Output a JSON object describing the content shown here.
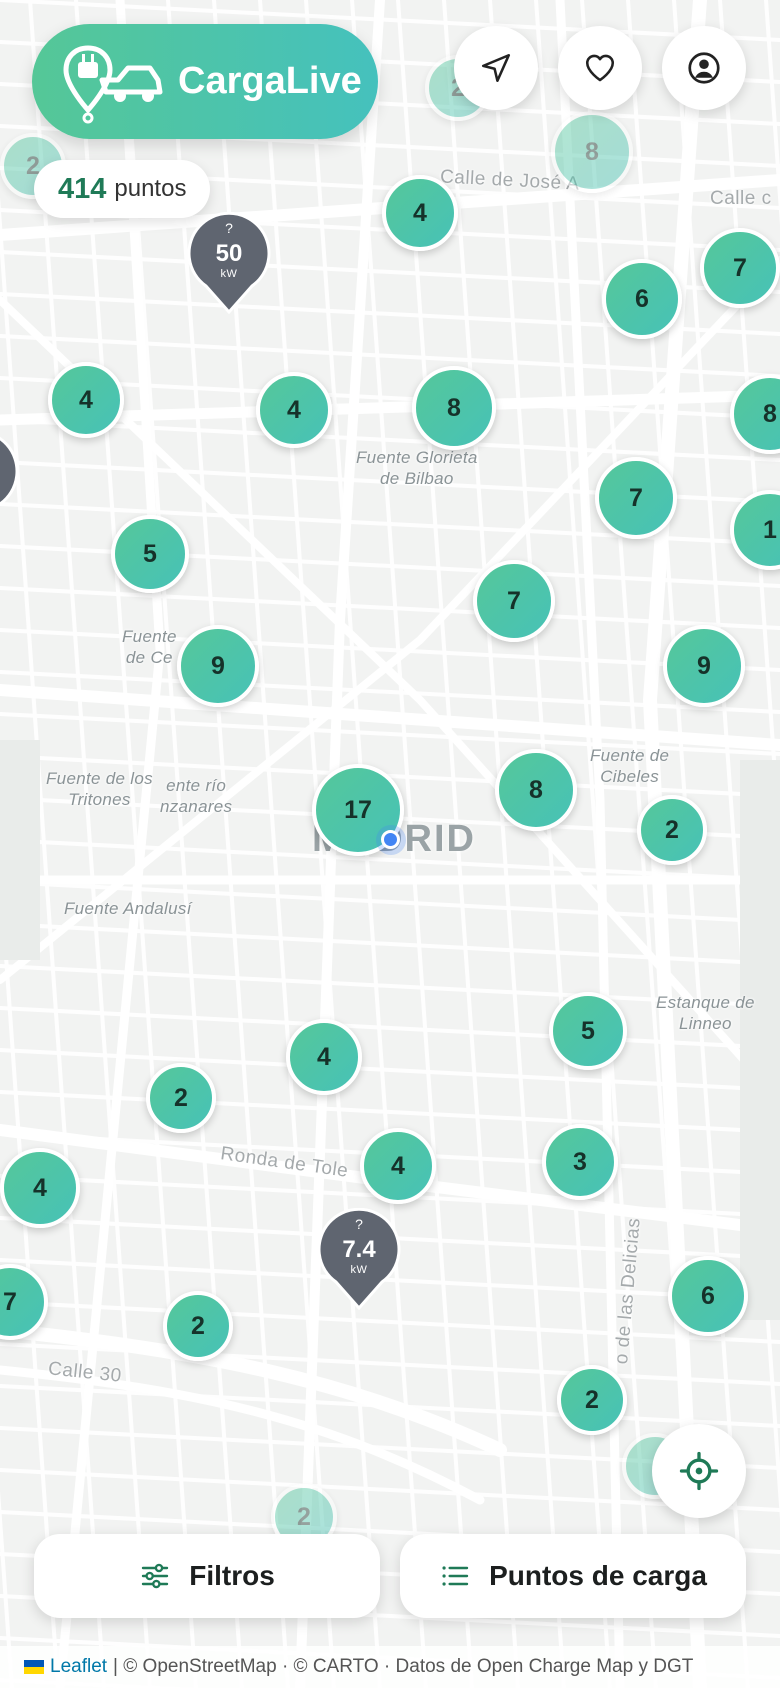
{
  "app": {
    "name": "CargaLive"
  },
  "header": {
    "navigate_icon": "navigation-arrow-icon",
    "favorites_icon": "heart-icon",
    "profile_icon": "user-circle-icon"
  },
  "points_count": {
    "number": "414",
    "label": "puntos"
  },
  "map": {
    "city_label": "MADRID",
    "user_location_icon": "blue-location-dot",
    "place_labels": [
      {
        "text": "Fuente Glorieta\nde Bilbao"
      },
      {
        "text": "Fuente de\nCibeles"
      },
      {
        "text": "Fuente de los\nTritones"
      },
      {
        "text": "ente río\nnzanares"
      },
      {
        "text": "Fuente Andalusí"
      },
      {
        "text": "Estanque de\nLinneo"
      },
      {
        "text": "Fuente\nde Ce"
      }
    ],
    "street_labels": [
      {
        "text": "Calle de José A"
      },
      {
        "text": "Ronda de Tole"
      },
      {
        "text": "Calle 30"
      },
      {
        "text": "Calle c"
      },
      {
        "text": "o de las Delicias"
      }
    ],
    "clusters": [
      {
        "count": "2",
        "faded": true
      },
      {
        "count": "8",
        "faded": true
      },
      {
        "count": "2",
        "faded": true
      },
      {
        "count": "4"
      },
      {
        "count": "7"
      },
      {
        "count": "6"
      },
      {
        "count": "4"
      },
      {
        "count": "4"
      },
      {
        "count": "8"
      },
      {
        "count": "8"
      },
      {
        "count": "7"
      },
      {
        "count": "1"
      },
      {
        "count": "5"
      },
      {
        "count": "7"
      },
      {
        "count": "9"
      },
      {
        "count": "9"
      },
      {
        "count": "17"
      },
      {
        "count": "8"
      },
      {
        "count": "2"
      },
      {
        "count": "5"
      },
      {
        "count": "4"
      },
      {
        "count": "2"
      },
      {
        "count": "4"
      },
      {
        "count": "4"
      },
      {
        "count": "3"
      },
      {
        "count": "7"
      },
      {
        "count": "2"
      },
      {
        "count": "6"
      },
      {
        "count": "2"
      },
      {
        "count": "2"
      },
      {
        "count": "2",
        "faded": true
      },
      {
        "count": "",
        "faded": true
      }
    ],
    "power_pins": [
      {
        "value": "50",
        "unit": "kW",
        "status_icon": "question-circle-icon"
      },
      {
        "value": "7.4",
        "unit": "kW",
        "status_icon": "question-circle-icon"
      }
    ]
  },
  "buttons": {
    "filters": "Filtros",
    "filters_icon": "sliders-icon",
    "charging_points": "Puntos de carga",
    "charging_points_icon": "list-icon",
    "locate_icon": "crosshair-icon"
  },
  "attribution": {
    "leaflet": "Leaflet",
    "rest": "| © OpenStreetMap · © CARTO · Datos de Open Charge Map y DGT"
  },
  "colors": {
    "brand_gradient_start": "#55c797",
    "brand_gradient_end": "#45c1bd",
    "cluster_text": "#16322a",
    "pin_gray": "#5f6570",
    "accent_dark_green": "#1f7a57"
  }
}
